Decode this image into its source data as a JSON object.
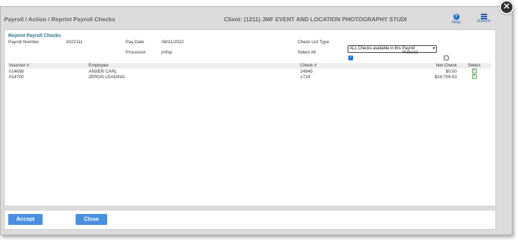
{
  "header": {
    "breadcrumb": "Payroll / Action / Reprint Payroll Checks",
    "client": "Client: (1211) JMF EVENT AND LOCATION PHOTOGRAPHY STUDI",
    "help_label": "Help",
    "actions_label": "Actions",
    "close_glyph": "×"
  },
  "form": {
    "section_title": "Reprint Payroll Checks",
    "payroll_number_label": "Payroll Number",
    "payroll_number": "2022111",
    "pay_date_label": "Pay Date",
    "pay_date": "08/31/2022",
    "processor_label": "Processor",
    "processor": "jmfsp",
    "check_list_type_label": "Check List Type",
    "check_list_type_value": "ALL Checks available in this Payroll",
    "select_all_label": "Select All",
    "select_all_checked": true,
    "rebuild_label": "Rebuild",
    "rebuild_checked": false
  },
  "table": {
    "columns": {
      "voucher": "Voucher #",
      "employee": "Employee",
      "check": "Check #",
      "net_check": "Net Check",
      "select": "Select"
    },
    "rows": [
      {
        "voucher": "014699",
        "employee": "ANSER CARL",
        "check": "24945",
        "net_check": "$0.00",
        "selected": true
      },
      {
        "voucher": "014700",
        "employee": "ZEROS LEADING",
        "check": "1719",
        "net_check": "$24,706.93",
        "selected": true
      }
    ]
  },
  "footer": {
    "accept_label": "Accept",
    "close_label": "Close"
  },
  "colors": {
    "accent_button": "#4a90e2",
    "section_title": "#2b7489",
    "link_blue": "#1f5ea8"
  }
}
